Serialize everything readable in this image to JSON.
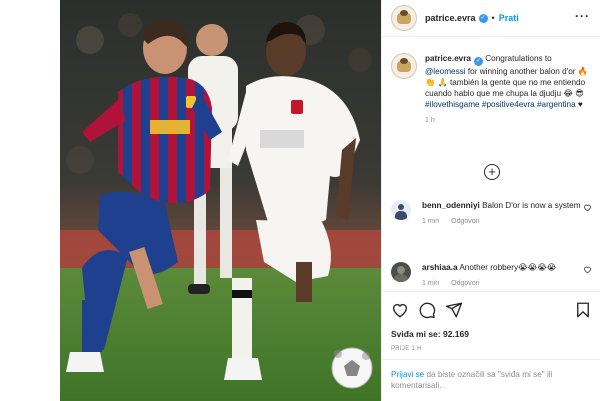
{
  "post": {
    "author": "patrice.evra",
    "follow_label": "Prati",
    "more_options": "more-horizontal-icon",
    "photo_description_icon": "football-photo"
  },
  "caption": {
    "author": "patrice.evra",
    "text_before_emoji": " Congratulations to ",
    "mention": "@leomessi",
    "text_mid": " for winning another balon d'or ",
    "emoji_1": "🔥 👏 🙏",
    "text_after": " también la gente que no me entiendo cuando hablo que me chupa la djudju ",
    "emoji_2": "😂 😎",
    "hashtags": "#ilovethisgame #positive4evra #argentina",
    "heart": " ♥",
    "time": "1 h"
  },
  "load_more_label": "+",
  "comments": [
    {
      "author": "benn_odenniyi",
      "text": "Balon D'or is now a system",
      "time": "1 min",
      "reply_label": "Odgovori"
    },
    {
      "author": "arshiaa.a",
      "text": "Another robbery",
      "emoji": "😭😭😭😭",
      "time": "1 min",
      "reply_label": "Odgovori"
    }
  ],
  "actions": {
    "like_icon": "heart-icon",
    "comment_icon": "comment-icon",
    "share_icon": "share-icon",
    "save_icon": "bookmark-icon"
  },
  "likes_label": "Sviđa mi se: 92.169",
  "post_time": "PRIJE 1 H",
  "login": {
    "link": "Prijavi se",
    "text": " da biste označili sa \"sviđa mi se\" ili komentarisali."
  },
  "colors": {
    "accent": "#0095f6",
    "verified": "#3897f0",
    "text": "#262626",
    "muted": "#8e8e8e",
    "barca_blue": "#1f3f8f",
    "barca_red": "#b0123a"
  }
}
